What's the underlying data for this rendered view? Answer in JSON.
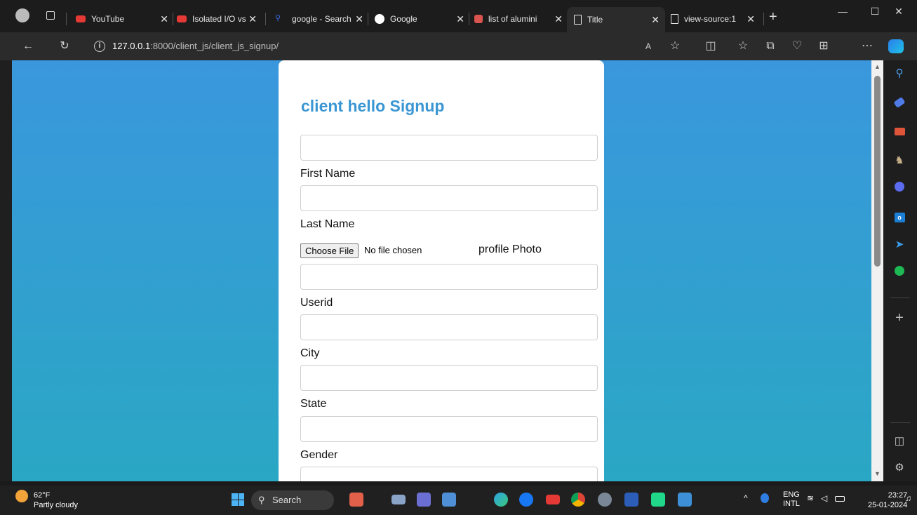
{
  "browser": {
    "tabs": [
      {
        "title": "YouTube",
        "icon": "youtube-icon",
        "color": "#e53935"
      },
      {
        "title": "Isolated I/O vs",
        "icon": "youtube-icon",
        "color": "#e53935"
      },
      {
        "title": "google - Search",
        "icon": "search-icon",
        "color": "#3a6df0"
      },
      {
        "title": "Google",
        "icon": "google-icon",
        "color": "#ffffff"
      },
      {
        "title": "list of alumini",
        "icon": "site-icon",
        "color": "#d9534f"
      },
      {
        "title": "Title",
        "icon": "page-icon",
        "color": "#e6e6e6"
      },
      {
        "title": "view-source:1",
        "icon": "page-icon",
        "color": "#e6e6e6"
      }
    ],
    "active_tab_index": 5,
    "address": {
      "host": "127.0.0.1",
      "path": ":8000/client_js/client_js_signup/"
    }
  },
  "form": {
    "title": "client hello Signup",
    "fields": {
      "top_input_value": "",
      "first_name_label": "First Name",
      "first_name_value": "",
      "last_name_label": "Last Name",
      "file_button": "Choose File",
      "file_status": "No file chosen",
      "profile_photo_label": "profile Photo",
      "userid_input_value": "",
      "userid_label": "Userid",
      "city_input_value": "",
      "city_label": "City",
      "state_input_value": "",
      "state_label": "State",
      "gender_input_value": "",
      "gender_label": "Gender"
    }
  },
  "taskbar": {
    "weather_temp": "62°F",
    "weather_desc": "Partly cloudy",
    "search_label": "Search",
    "language_line1": "ENG",
    "language_line2": "INTL",
    "time": "23:27",
    "date": "25-01-2024"
  },
  "colors": {
    "accent": "#3a97d4",
    "gradient_top": "#3a97dd",
    "gradient_bottom": "#2aa7c4"
  }
}
